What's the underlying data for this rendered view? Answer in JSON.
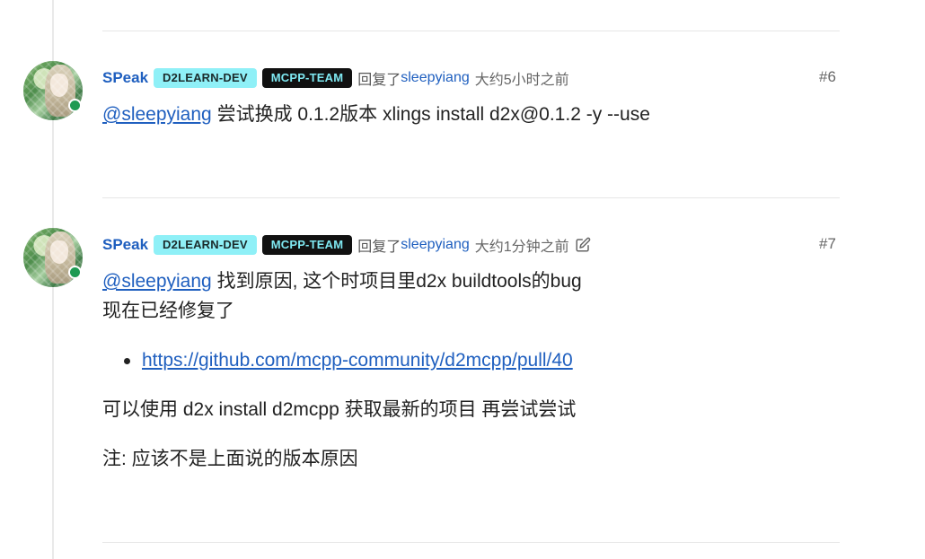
{
  "posts": [
    {
      "username": "SPeak",
      "badges": [
        "D2LEARN-DEV",
        "MCPP-TEAM"
      ],
      "reply_prefix": "回复了",
      "reply_to": "sleepyiang",
      "time": "大约5小时之前",
      "number": "#6",
      "body": {
        "mention": "@sleepyiang",
        "text": " 尝试换成 0.1.2版本 xlings install d2x@0.1.2 -y --use"
      }
    },
    {
      "username": "SPeak",
      "badges": [
        "D2LEARN-DEV",
        "MCPP-TEAM"
      ],
      "reply_prefix": "回复了",
      "reply_to": "sleepyiang",
      "time": "大约1分钟之前",
      "edited_icon": "edit-icon",
      "number": "#7",
      "body": {
        "mention": "@sleepyiang",
        "line1_text": " 找到原因, 这个时项目里d2x buildtools的bug",
        "line2": "现在已经修复了",
        "link": "https://github.com/mcpp-community/d2mcpp/pull/40",
        "para1": "可以使用 d2x install d2mcpp 获取最新的项目 再尝试尝试",
        "para2": "注: 应该不是上面说的版本原因"
      }
    }
  ],
  "colors": {
    "accent": "#1f5fbf",
    "online": "#1e9a52",
    "badge_d2": "#8ff0f7",
    "badge_mcpp": "#111111"
  }
}
